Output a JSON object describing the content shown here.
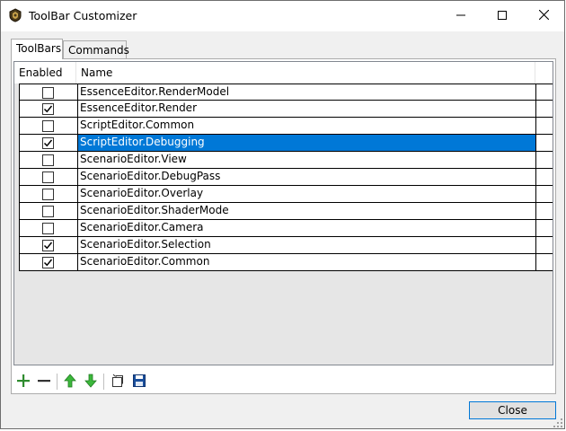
{
  "window": {
    "title": "ToolBar Customizer"
  },
  "tabs": [
    {
      "label": "ToolBars"
    },
    {
      "label": "Commands"
    }
  ],
  "grid": {
    "headers": {
      "enabled": "Enabled",
      "name": "Name"
    },
    "rows": [
      {
        "name": "EssenceEditor.RenderModel",
        "enabled": false
      },
      {
        "name": "EssenceEditor.Render",
        "enabled": true
      },
      {
        "name": "ScriptEditor.Common",
        "enabled": false
      },
      {
        "name": "ScriptEditor.Debugging",
        "enabled": true,
        "selected": true
      },
      {
        "name": "ScenarioEditor.View",
        "enabled": false
      },
      {
        "name": "ScenarioEditor.DebugPass",
        "enabled": false
      },
      {
        "name": "ScenarioEditor.Overlay",
        "enabled": false
      },
      {
        "name": "ScenarioEditor.ShaderMode",
        "enabled": false
      },
      {
        "name": "ScenarioEditor.Camera",
        "enabled": false
      },
      {
        "name": "ScenarioEditor.Selection",
        "enabled": true
      },
      {
        "name": "ScenarioEditor.Common",
        "enabled": true
      }
    ]
  },
  "toolbar": {
    "icons": [
      "add-icon",
      "remove-icon",
      "move-up-icon",
      "move-down-icon",
      "open-icon",
      "save-icon"
    ]
  },
  "buttons": {
    "close_label": "Close"
  },
  "colors": {
    "selection": "#0078d7",
    "add_green": "#2e8b2e",
    "arrow_green": "#3cb83c",
    "save_blue": "#1a4f9c"
  }
}
